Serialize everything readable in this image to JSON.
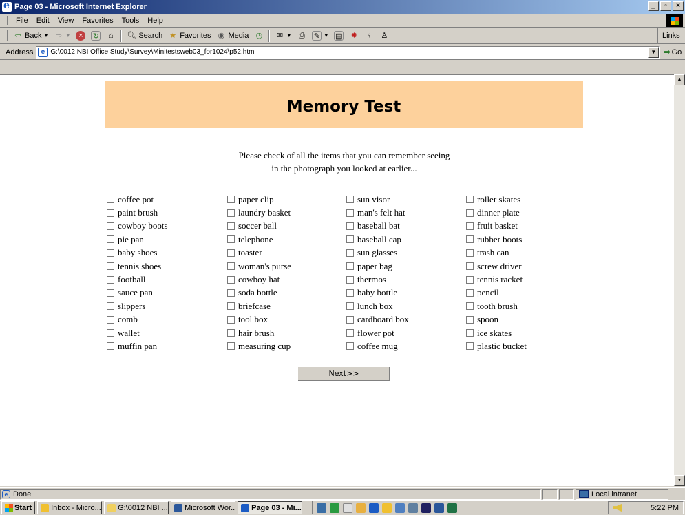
{
  "window": {
    "title": "Page 03 - Microsoft Internet Explorer",
    "controls": [
      "_",
      "ē",
      "X"
    ]
  },
  "menu": [
    "File",
    "Edit",
    "View",
    "Favorites",
    "Tools",
    "Help"
  ],
  "toolbar": {
    "back": "Back",
    "search": "Search",
    "favorites": "Favorites",
    "media": "Media",
    "links": "Links"
  },
  "address": {
    "label": "Address",
    "url": "G:\\0012 NBI Office Study\\Survey\\Minitestsweb03_for1024\\p52.htm",
    "go": "Go"
  },
  "page": {
    "heading": "Memory Test",
    "instruction_line1": "Please check of all the items that you can remember seeing",
    "instruction_line2": "in the photograph you looked at earlier...",
    "columns": [
      [
        "coffee pot",
        "paint brush",
        "cowboy boots",
        "pie pan",
        "baby shoes",
        "tennis shoes",
        "football",
        "sauce pan",
        "slippers",
        "comb",
        "wallet",
        "muffin pan"
      ],
      [
        "paper clip",
        "laundry basket",
        "soccer ball",
        "telephone",
        "toaster",
        "woman's purse",
        "cowboy hat",
        "soda bottle",
        "briefcase",
        "tool box",
        "hair brush",
        "measuring cup"
      ],
      [
        "sun visor",
        "man's felt hat",
        "baseball bat",
        "baseball cap",
        "sun glasses",
        "paper bag",
        "thermos",
        "baby bottle",
        "lunch box",
        "cardboard box",
        "flower pot",
        "coffee mug"
      ],
      [
        "roller skates",
        "dinner plate",
        "fruit basket",
        "rubber boots",
        "trash can",
        "screw driver",
        "tennis racket",
        "pencil",
        "tooth brush",
        "spoon",
        "ice skates",
        "plastic bucket"
      ]
    ],
    "next_label": "Next>>"
  },
  "status": {
    "text": "Done",
    "zone": "Local intranet"
  },
  "taskbar": {
    "start": "Start",
    "tasks": [
      {
        "label": "Inbox - Micro...",
        "color": "#f0c030"
      },
      {
        "label": "G:\\0012 NBI ...",
        "color": "#f0d060"
      },
      {
        "label": "Microsoft Wor...",
        "color": "#2b579a"
      },
      {
        "label": "Page 03 - Mi...",
        "color": "#1c5cc4",
        "active": true
      }
    ],
    "clock": "5:22 PM"
  }
}
